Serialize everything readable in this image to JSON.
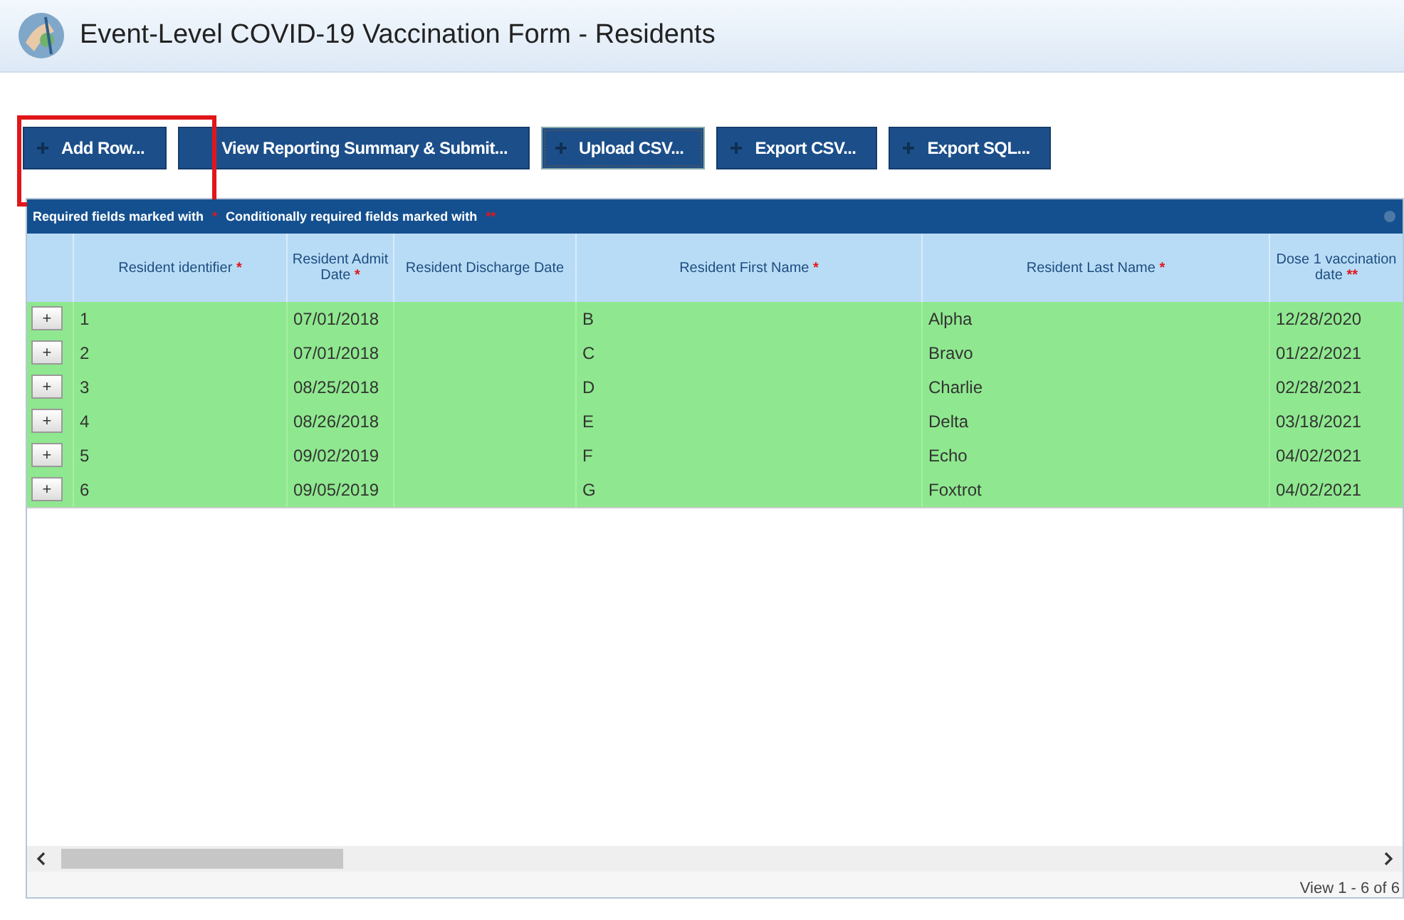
{
  "window": {
    "title": "Event-Level COVID-19 Vaccination Form - Residents"
  },
  "toolbar": {
    "buttons": [
      {
        "label": "Add Row...",
        "focused": false,
        "highlighted": true
      },
      {
        "label": "View Reporting Summary & Submit...",
        "focused": false,
        "highlighted": false
      },
      {
        "label": "Upload CSV...",
        "focused": true,
        "highlighted": false
      },
      {
        "label": "Export CSV...",
        "focused": false,
        "highlighted": false
      },
      {
        "label": "Export SQL...",
        "focused": false,
        "highlighted": false
      }
    ]
  },
  "table": {
    "caption": [
      {
        "text": "Required fields marked with",
        "marker": "*"
      },
      {
        "text": "Conditionally required fields marked with",
        "marker": "**"
      }
    ],
    "columns": [
      {
        "label": "Resident identifier",
        "marker": "*"
      },
      {
        "label": "Resident Admit Date",
        "marker": "*"
      },
      {
        "label": "Resident Discharge Date"
      },
      {
        "label": "Resident First Name",
        "marker": "*"
      },
      {
        "label": "Resident Last Name",
        "marker": "*"
      },
      {
        "label": "Dose 1 vaccination date",
        "marker": "**"
      }
    ],
    "rows": [
      {
        "expand": "+",
        "cells": [
          "1",
          "07/01/2018",
          "",
          "B",
          "Alpha",
          "12/28/2020"
        ]
      },
      {
        "expand": "+",
        "cells": [
          "2",
          "07/01/2018",
          "",
          "C",
          "Bravo",
          "01/22/2021"
        ]
      },
      {
        "expand": "+",
        "cells": [
          "3",
          "08/25/2018",
          "",
          "D",
          "Charlie",
          "02/28/2021"
        ]
      },
      {
        "expand": "+",
        "cells": [
          "4",
          "08/26/2018",
          "",
          "E",
          "Delta",
          "03/18/2021"
        ]
      },
      {
        "expand": "+",
        "cells": [
          "5",
          "09/02/2019",
          "",
          "F",
          "Echo",
          "04/02/2021"
        ]
      },
      {
        "expand": "+",
        "cells": [
          "6",
          "09/05/2019",
          "",
          "G",
          "Foxtrot",
          "04/02/2021"
        ]
      }
    ],
    "footer": "View 1 - 6 of 6"
  }
}
